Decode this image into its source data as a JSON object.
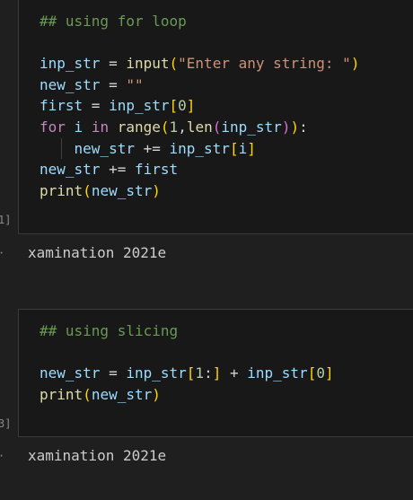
{
  "cell1": {
    "lines": [
      [
        {
          "t": "## using for loop",
          "c": "c-comment"
        }
      ],
      [],
      [
        {
          "t": "inp_str",
          "c": "c-var"
        },
        {
          "t": " = ",
          "c": "c-op"
        },
        {
          "t": "input",
          "c": "c-fn"
        },
        {
          "t": "(",
          "c": "c-b1"
        },
        {
          "t": "\"Enter any string: \"",
          "c": "c-str"
        },
        {
          "t": ")",
          "c": "c-b1"
        }
      ],
      [
        {
          "t": "new_str",
          "c": "c-var"
        },
        {
          "t": " = ",
          "c": "c-op"
        },
        {
          "t": "\"\"",
          "c": "c-str"
        }
      ],
      [
        {
          "t": "first",
          "c": "c-var"
        },
        {
          "t": " = ",
          "c": "c-op"
        },
        {
          "t": "inp_str",
          "c": "c-var"
        },
        {
          "t": "[",
          "c": "c-b1"
        },
        {
          "t": "0",
          "c": "c-num"
        },
        {
          "t": "]",
          "c": "c-b1"
        }
      ],
      [
        {
          "t": "for",
          "c": "c-kw"
        },
        {
          "t": " ",
          "c": "c-op"
        },
        {
          "t": "i",
          "c": "c-var"
        },
        {
          "t": " ",
          "c": "c-op"
        },
        {
          "t": "in",
          "c": "c-kw"
        },
        {
          "t": " ",
          "c": "c-op"
        },
        {
          "t": "range",
          "c": "c-fn"
        },
        {
          "t": "(",
          "c": "c-b1"
        },
        {
          "t": "1",
          "c": "c-num"
        },
        {
          "t": ",",
          "c": "c-op"
        },
        {
          "t": "len",
          "c": "c-fn"
        },
        {
          "t": "(",
          "c": "c-b2"
        },
        {
          "t": "inp_str",
          "c": "c-var"
        },
        {
          "t": ")",
          "c": "c-b2"
        },
        {
          "t": ")",
          "c": "c-b1"
        },
        {
          "t": ":",
          "c": "c-op"
        }
      ],
      [
        {
          "t": "    ",
          "c": "c-op",
          "guide": true
        },
        {
          "t": "new_str",
          "c": "c-var"
        },
        {
          "t": " += ",
          "c": "c-op"
        },
        {
          "t": "inp_str",
          "c": "c-var"
        },
        {
          "t": "[",
          "c": "c-b1"
        },
        {
          "t": "i",
          "c": "c-var"
        },
        {
          "t": "]",
          "c": "c-b1"
        }
      ],
      [
        {
          "t": "new_str",
          "c": "c-var"
        },
        {
          "t": " += ",
          "c": "c-op"
        },
        {
          "t": "first",
          "c": "c-var"
        }
      ],
      [
        {
          "t": "print",
          "c": "c-fn"
        },
        {
          "t": "(",
          "c": "c-b1"
        },
        {
          "t": "new_str",
          "c": "c-var"
        },
        {
          "t": ")",
          "c": "c-b1"
        }
      ]
    ],
    "exec_count": "1]",
    "output": "xamination 2021e"
  },
  "cell2": {
    "lines": [
      [
        {
          "t": "## using slicing",
          "c": "c-comment"
        }
      ],
      [],
      [
        {
          "t": "new_str",
          "c": "c-var"
        },
        {
          "t": " = ",
          "c": "c-op"
        },
        {
          "t": "inp_str",
          "c": "c-var"
        },
        {
          "t": "[",
          "c": "c-b1"
        },
        {
          "t": "1",
          "c": "c-num"
        },
        {
          "t": ":",
          "c": "c-op"
        },
        {
          "t": "]",
          "c": "c-b1"
        },
        {
          "t": " + ",
          "c": "c-op"
        },
        {
          "t": "inp_str",
          "c": "c-var"
        },
        {
          "t": "[",
          "c": "c-b1"
        },
        {
          "t": "0",
          "c": "c-num"
        },
        {
          "t": "]",
          "c": "c-b1"
        }
      ],
      [
        {
          "t": "print",
          "c": "c-fn"
        },
        {
          "t": "(",
          "c": "c-b1"
        },
        {
          "t": "new_str",
          "c": "c-var"
        },
        {
          "t": ")",
          "c": "c-b1"
        }
      ]
    ],
    "exec_count": "3]",
    "output": "xamination 2021e"
  },
  "output_arrow": "·"
}
